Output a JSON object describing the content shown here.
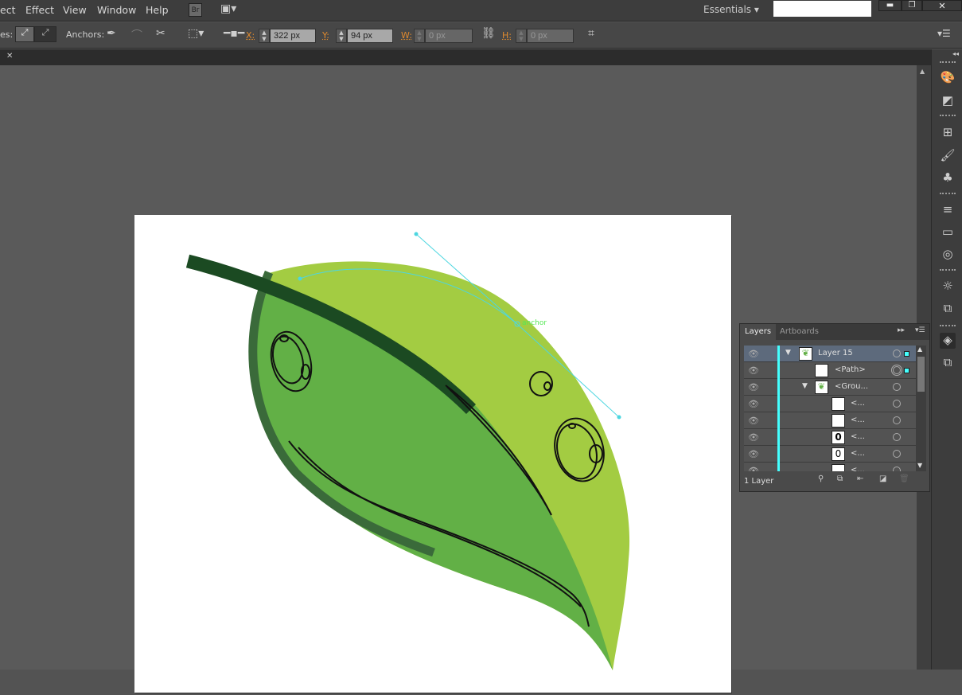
{
  "menubar": {
    "items": [
      "ect",
      "Effect",
      "View",
      "Window",
      "Help"
    ],
    "bridge": "Br",
    "workspace": "Essentials",
    "search_value": ""
  },
  "control": {
    "handles_label": "es:",
    "anchors_label": "Anchors:",
    "x_label": "X:",
    "x_value": "322 px",
    "y_label": "Y:",
    "y_value": "94 px",
    "w_label": "W:",
    "w_value": "0 px",
    "h_label": "H:",
    "h_value": "0 px"
  },
  "canvas": {
    "smart_guide_label": "anchor",
    "colors": {
      "light_leaf": "#a3cc42",
      "mid_leaf": "#62b046",
      "outline": "#3a6a3a",
      "stem": "#1b4a22",
      "path": "#4dd6e0"
    }
  },
  "layers_panel": {
    "tabs": [
      "Layers",
      "Artboards"
    ],
    "rows": [
      {
        "name": "Layer 15",
        "indent": 0,
        "expanded": true,
        "selected": true
      },
      {
        "name": "<Path>",
        "indent": 1,
        "targeted": true
      },
      {
        "name": "<Grou...",
        "indent": 1,
        "expanded": true
      },
      {
        "name": "<...",
        "indent": 2
      },
      {
        "name": "<...",
        "indent": 2
      },
      {
        "name": "<...",
        "indent": 2
      },
      {
        "name": "<...",
        "indent": 2
      },
      {
        "name": "<...",
        "indent": 2
      }
    ],
    "footer": "1 Layer"
  }
}
